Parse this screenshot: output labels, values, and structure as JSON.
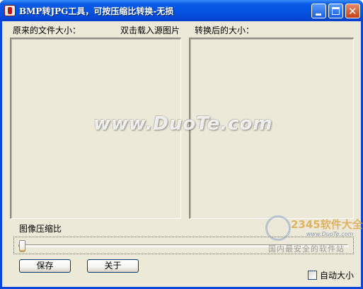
{
  "window": {
    "title": "BMP转JPG工具，可按压缩比转换-无损"
  },
  "labels": {
    "original_size": "原来的文件大小：",
    "load_hint": "双击载入源图片",
    "converted_size": "转换后的大小：",
    "compression_ratio": "图像压缩比"
  },
  "slider": {
    "value_fraction": 0.0
  },
  "buttons": {
    "save": "保存",
    "about": "关于"
  },
  "checkbox": {
    "auto_size_label": "自动大小",
    "checked": false
  },
  "watermarks": {
    "duote": "www.DuoTe.com",
    "logo_number": "2345软件大全",
    "logo_site": "www.DuoTe.com",
    "slogan": "国内最安全的软件站"
  },
  "colors": {
    "titlebar": "#0554e4",
    "client_background": "#ece9d8",
    "close_button": "#c84018"
  }
}
